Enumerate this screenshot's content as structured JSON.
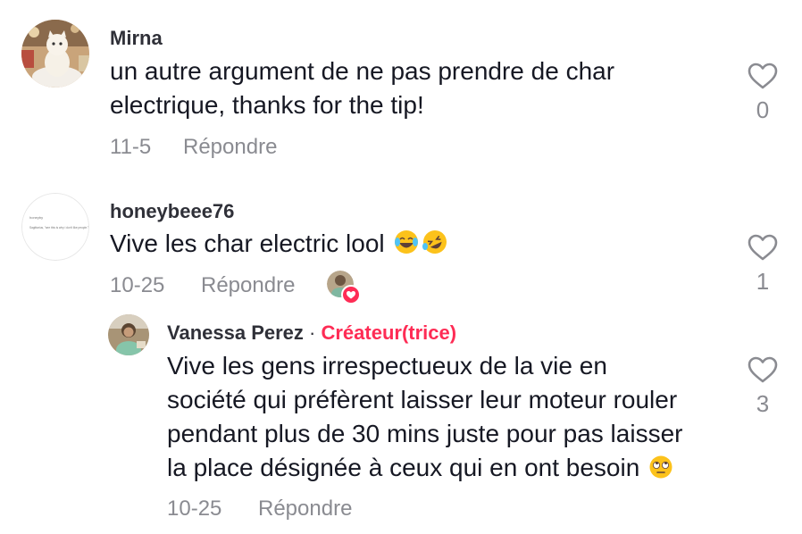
{
  "comments": [
    {
      "username": "Mirna",
      "text_lines": [
        "un autre argument de ne pas prendre de char",
        "electrique, thanks for the tip!"
      ],
      "date": "11-5",
      "reply_label": "Répondre",
      "likes": "0"
    },
    {
      "username": "honeybeee76",
      "text": "Vive les char electric lool",
      "emojis": [
        "face-with-tears-of-joy-icon",
        "rolling-on-floor-laughing-icon"
      ],
      "date": "10-25",
      "reply_label": "Répondre",
      "likes": "1",
      "avatar_text": [
        "honeyby",
        "Sagittarius, \"see this is why i don't like people.\""
      ]
    }
  ],
  "reply": {
    "username": "Vanessa Perez",
    "separator": "·",
    "creator_label": "Créateur(trice)",
    "text_lines": [
      "Vive les gens irrespectueux de la vie en",
      "société qui préfèrent laisser leur moteur rouler",
      "pendant plus de 30 mins juste pour pas laisser",
      "la place désignée à ceux qui en ont besoin"
    ],
    "emoji": "face-with-rolling-eyes-icon",
    "date": "10-25",
    "reply_label": "Répondre",
    "likes": "3"
  },
  "colors": {
    "accent": "#fe2c55",
    "meta_gray": "#8a8b91",
    "text": "#161823"
  }
}
